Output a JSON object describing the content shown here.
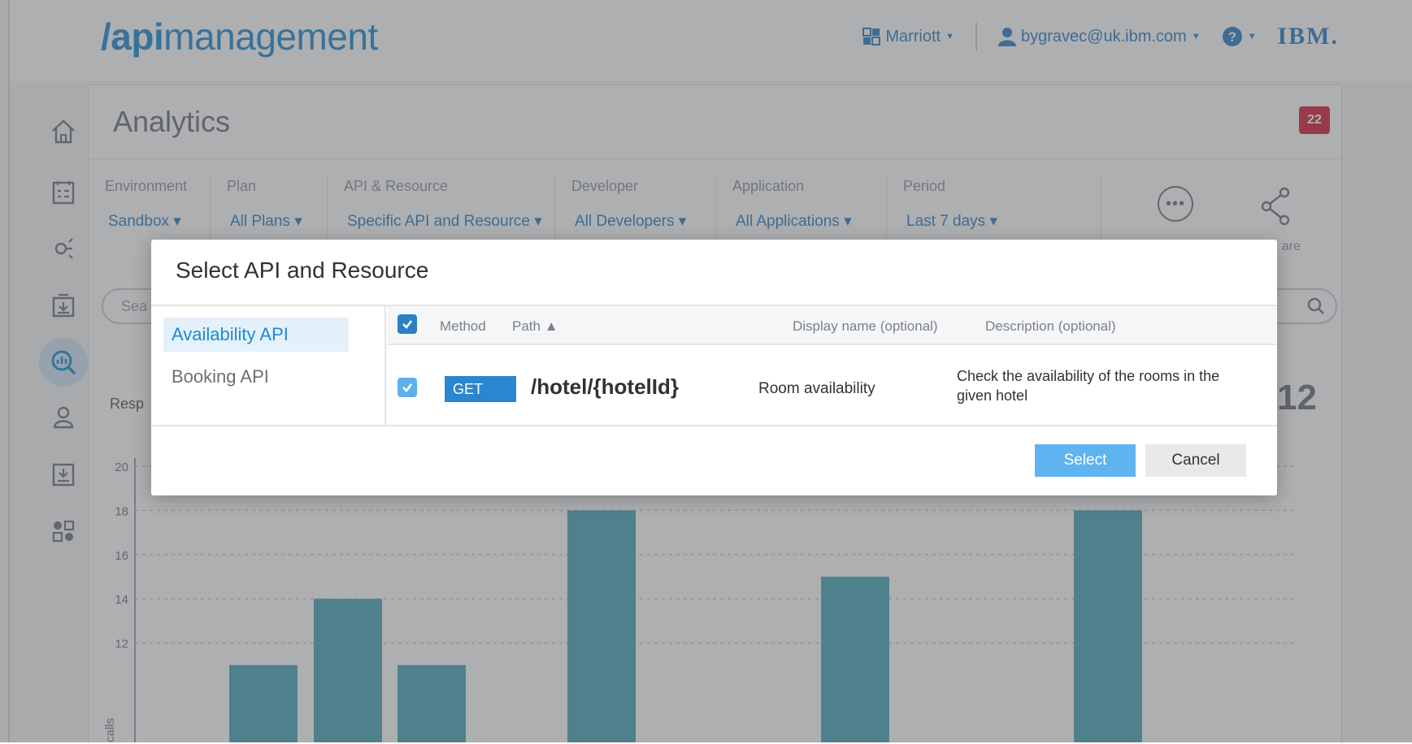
{
  "header": {
    "brand_prefix": "/api",
    "brand_suffix": "management",
    "org": "Marriott",
    "user": "bygravec@uk.ibm.com",
    "vendor": "IBM."
  },
  "sidebar": {
    "items": [
      "home-icon",
      "checklist-icon",
      "api-icon",
      "catalog-icon",
      "analytics-icon",
      "users-icon",
      "import-icon",
      "apps-icon"
    ],
    "active": "analytics-icon"
  },
  "page": {
    "title": "Analytics",
    "notification_count": "22"
  },
  "filters": [
    {
      "label": "Environment",
      "value": "Sandbox"
    },
    {
      "label": "Plan",
      "value": "All Plans"
    },
    {
      "label": "API & Resource",
      "value": "Specific API and Resource"
    },
    {
      "label": "Developer",
      "value": "All Developers"
    },
    {
      "label": "Application",
      "value": "All Applications"
    },
    {
      "label": "Period",
      "value": "Last 7 days"
    }
  ],
  "share_label": "are",
  "search": {
    "placeholder_partial": "Sea"
  },
  "metric": {
    "label_partial": "Resp",
    "value_partial": "12"
  },
  "chart_data": {
    "type": "bar",
    "ylabel_partial": "calls",
    "y_ticks": [
      12,
      14,
      16,
      18,
      20
    ],
    "ylim": [
      10,
      20
    ],
    "values": [
      11,
      14,
      11,
      18,
      15,
      18
    ],
    "grid": true,
    "bar_color": "#4aa8ba"
  },
  "modal": {
    "title": "Select API and Resource",
    "apis": [
      {
        "label": "Availability API",
        "selected": true
      },
      {
        "label": "Booking API",
        "selected": false
      }
    ],
    "columns": {
      "method": "Method",
      "path": "Path ▲",
      "display_name": "Display name (optional)",
      "description": "Description (optional)"
    },
    "rows": [
      {
        "method": "GET",
        "path": "/hotel/{hotelId}",
        "display_name": "Room availability",
        "description": "Check the availability of the rooms in the given hotel",
        "checked": true
      }
    ],
    "select_label": "Select",
    "cancel_label": "Cancel"
  },
  "colors": {
    "brand_blue": "#1e8ad4",
    "badge_red": "#d3213d",
    "bar_teal": "#4aa8ba"
  }
}
